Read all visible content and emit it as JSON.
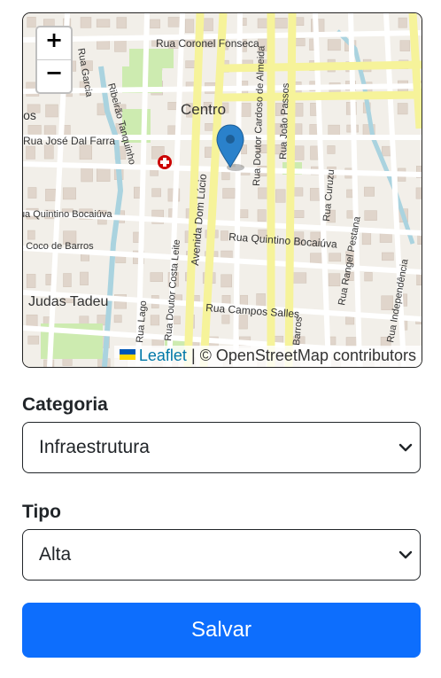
{
  "map": {
    "zoom_in": "+",
    "zoom_out": "−",
    "attribution_link": "Leaflet",
    "attribution_text": " | © OpenStreetMap contributors",
    "labels": {
      "coronel_fonseca": "Rua Coronel Fonseca",
      "centro": "Centro",
      "jose_farra": "Rua José Dal Farra",
      "ribeirao": "Ribeirão Tanquinho",
      "cardoso": "Rua Doutor Cardoso de Almeida",
      "joao_passos": "Rua João Passos",
      "quintino_left": "Rua Quintino Bocaiúva",
      "quintino": "Rua Quintino Bocaiúva",
      "avenida_lucio": "Avenida Dom Lúcio",
      "curuzu": "Rua Curuzu",
      "barros_left": "Rua Coco de Barros",
      "judas": "Judas Tadeu",
      "costa_leite": "Rua Doutor Costa Leite",
      "lago": "Rua Lago",
      "campos_salles": "Rua Campos Salles",
      "rangel": "Rua Rangel Pestana",
      "independencia": "Rua Independência",
      "garcia": "Rua Garcia",
      "barros": "Barros",
      "ricos": "icos"
    }
  },
  "categoria": {
    "label": "Categoria",
    "value": "Infraestrutura"
  },
  "tipo": {
    "label": "Tipo",
    "value": "Alta"
  },
  "submit_label": "Salvar",
  "colors": {
    "primary": "#0d6efd",
    "major_road": "#f6f39a",
    "river": "#aad3df",
    "park": "#cdebb0",
    "marker": "#2a81cb"
  }
}
